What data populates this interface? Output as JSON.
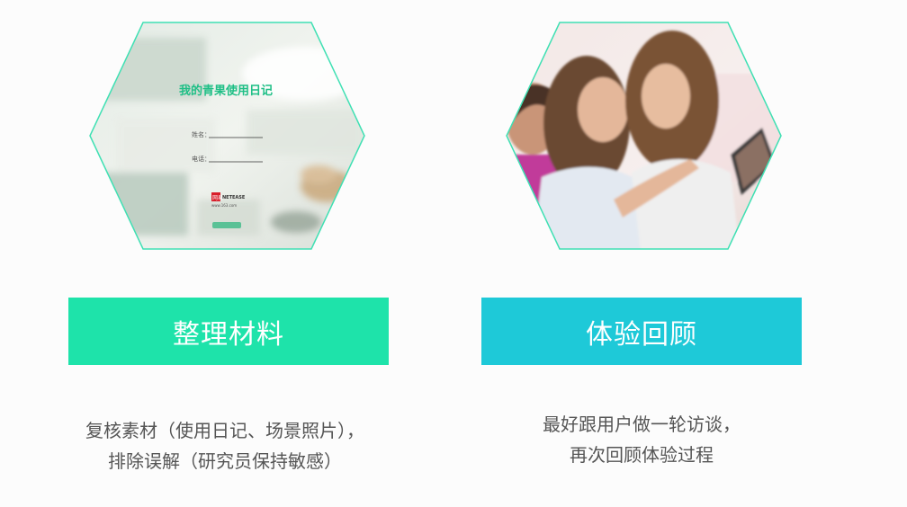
{
  "left_card": {
    "diary": {
      "title": "我的青果使用日记",
      "name_label": "姓名：",
      "phone_label": "电话：",
      "logo_text": "网易",
      "logo_brand": "NETEASE",
      "logo_url": "www.163.com"
    },
    "banner_label": "整理材料",
    "desc_lines": [
      "复核素材（使用日记、场景照片），",
      "排除误解（研究员保持敏感）"
    ]
  },
  "right_card": {
    "banner_label": "体验回顾",
    "desc_lines": [
      "最好跟用户做一轮访谈，",
      "再次回顾体验过程"
    ]
  },
  "colors": {
    "banner_left": "#1ee3aa",
    "banner_right": "#1ec9d8",
    "hex_border": "#3fe0b3",
    "diary_title": "#1fbf86",
    "logo_red": "#d81e2a"
  }
}
